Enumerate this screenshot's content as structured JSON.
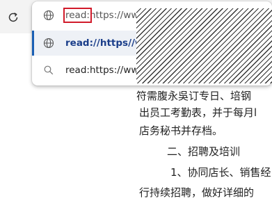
{
  "toolbar": {
    "reload_icon": "reload-icon"
  },
  "omnibox": {
    "typed_text": "read:",
    "rest_text": "https://www",
    "icon": "globe-icon"
  },
  "suggestions": [
    {
      "text": "read://https//w",
      "icon": "globe-icon",
      "selected": true
    },
    {
      "text": "read:https://www",
      "icon": "search-icon",
      "selected": false
    }
  ],
  "document": {
    "lines": [
      "符需腹永吳订专日、培钢",
      "出员工考勤表，并于每月l",
      "店务秘书并存档。",
      "二、招聘及培训",
      "1、协同店长、销售经",
      "行持续招聘，做好详细的"
    ]
  },
  "colors": {
    "selection_bar": "#1a5fb4",
    "highlight_border": "#d11a2a",
    "selected_text": "#1b3e8a"
  }
}
